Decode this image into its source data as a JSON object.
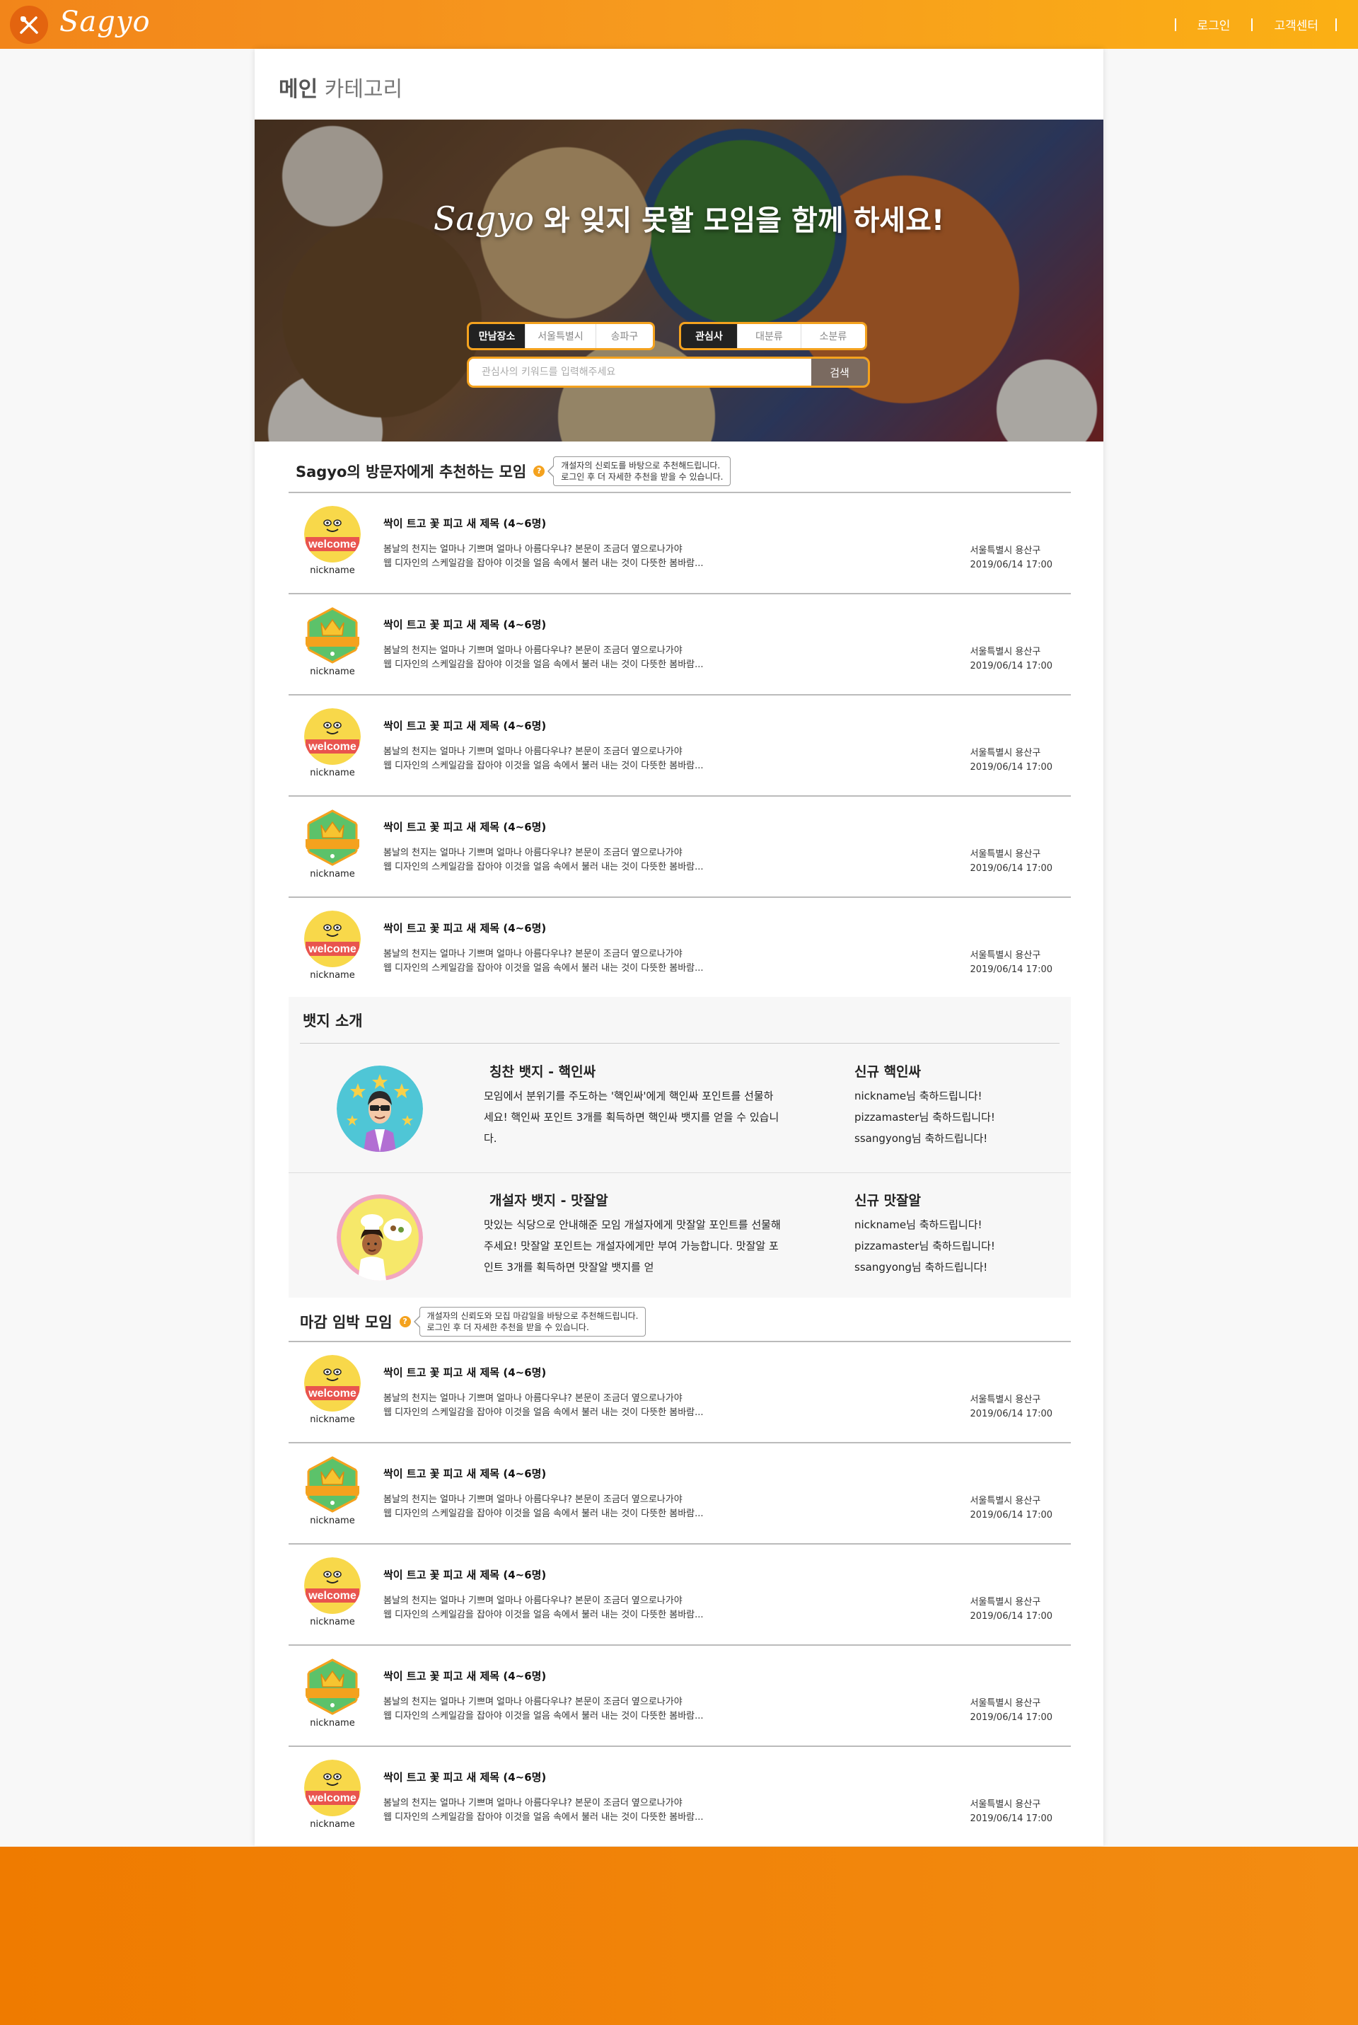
{
  "header": {
    "logo_text": "Sagyo",
    "nav": [
      "로그인",
      "고객센터"
    ],
    "accent": "#f7941d"
  },
  "page": {
    "heading_main": "메인",
    "heading_sub": "카테고리"
  },
  "hero": {
    "brand": "Sagyo",
    "title": "와 잊지 못할 모임을 함께 하세요!",
    "place_filter": [
      "만남장소",
      "서울특별시",
      "송파구"
    ],
    "interest_filter": [
      "관심사",
      "대분류",
      "소분류"
    ],
    "search_placeholder": "관심사의 키워드를 입력해주세요",
    "search_button": "검색"
  },
  "recommend": {
    "title": "Sagyo의 방문자에게 추천하는 모임",
    "help_icon": "question-icon",
    "tooltip": [
      "개설자의 신뢰도를 바탕으로 추천해드립니다.",
      "로그인 후 더 자세한 추천을 받을 수 있습니다."
    ],
    "items": [
      {
        "avatar": "welcome",
        "nickname": "nickname",
        "title": "싹이 트고 꽃 피고 새 제목 (4~6명)",
        "desc1": "봄날의 천지는 얼마나 기쁘며 얼마나 아름다우냐? 본문이 조금더 옆으로나가야",
        "desc2": "웹 디자인의 스케일감을 잡아야 이것을 얼음 속에서 불러 내는 것이 다뜻한 봄바람...",
        "location": "서울특별시 용산구",
        "datetime": "2019/06/14  17:00"
      },
      {
        "avatar": "badge",
        "nickname": "nickname",
        "title": "싹이 트고 꽃 피고 새 제목 (4~6명)",
        "desc1": "봄날의 천지는 얼마나 기쁘며 얼마나 아름다우냐? 본문이 조금더 옆으로나가야",
        "desc2": "웹 디자인의 스케일감을 잡아야 이것을 얼음 속에서 불러 내는 것이 다뜻한 봄바람...",
        "location": "서울특별시 용산구",
        "datetime": "2019/06/14  17:00"
      },
      {
        "avatar": "welcome",
        "nickname": "nickname",
        "title": "싹이 트고 꽃 피고 새 제목 (4~6명)",
        "desc1": "봄날의 천지는 얼마나 기쁘며 얼마나 아름다우냐? 본문이 조금더 옆으로나가야",
        "desc2": "웹 디자인의 스케일감을 잡아야 이것을 얼음 속에서 불러 내는 것이 다뜻한 봄바람...",
        "location": "서울특별시 용산구",
        "datetime": "2019/06/14  17:00"
      },
      {
        "avatar": "badge",
        "nickname": "nickname",
        "title": "싹이 트고 꽃 피고 새 제목 (4~6명)",
        "desc1": "봄날의 천지는 얼마나 기쁘며 얼마나 아름다우냐? 본문이 조금더 옆으로나가야",
        "desc2": "웹 디자인의 스케일감을 잡아야 이것을 얼음 속에서 불러 내는 것이 다뜻한 봄바람...",
        "location": "서울특별시 용산구",
        "datetime": "2019/06/14  17:00"
      },
      {
        "avatar": "welcome",
        "nickname": "nickname",
        "title": "싹이 트고 꽃 피고 새 제목 (4~6명)",
        "desc1": "봄날의 천지는 얼마나 기쁘며 얼마나 아름다우냐? 본문이 조금더 옆으로나가야",
        "desc2": "웹 디자인의 스케일감을 잡아야 이것을 얼음 속에서 불러 내는 것이 다뜻한 봄바람...",
        "location": "서울특별시 용산구",
        "datetime": "2019/06/14  17:00"
      }
    ]
  },
  "badges": {
    "title": "뱃지 소개",
    "rows": [
      {
        "icon": "praise-badge-icon",
        "title": "칭찬 뱃지 - 핵인싸",
        "desc": " 모임에서 분위기를 주도하는 '핵인싸'에게 핵인싸 포인트를 선물하세요! 핵인싸 포인트 3개를 획득하면 핵인싸 뱃지를 얻을 수 있습니다.",
        "new_title": "신규 핵인싸",
        "new_list": [
          "nickname님 축하드립니다!",
          "pizzamaster님 축하드립니다!",
          "ssangyong님 축하드립니다!"
        ]
      },
      {
        "icon": "chef-badge-icon",
        "title": "개설자 뱃지 - 맛잘알",
        "desc": " 맛있는 식당으로 안내해준 모임 개설자에게 맛잘알 포인트를 선물해주세요! 맛잘알 포인트는 개설자에게만 부여 가능합니다. 맛잘알 포인트 3개를 획득하면 맛잘알 뱃지를 얻",
        "new_title": "신규 맛잘알",
        "new_list": [
          "nickname님 축하드립니다!",
          "pizzamaster님 축하드립니다!",
          "ssangyong님 축하드립니다!"
        ]
      }
    ]
  },
  "deadline": {
    "title": "마감 임박 모임",
    "help_icon": "question-icon",
    "tooltip": [
      "개설자의 신뢰도와 모집 마감일을 바탕으로 추천해드립니다.",
      "로그인 후 더 자세한 추천을 받을 수 있습니다."
    ],
    "items": [
      {
        "avatar": "welcome",
        "nickname": "nickname",
        "title": "싹이 트고 꽃 피고 새 제목 (4~6명)",
        "desc1": "봄날의 천지는 얼마나 기쁘며 얼마나 아름다우냐? 본문이 조금더 옆으로나가야",
        "desc2": "웹 디자인의 스케일감을 잡아야 이것을 얼음 속에서 불러 내는 것이 다뜻한 봄바람...",
        "location": "서울특별시 용산구",
        "datetime": "2019/06/14  17:00"
      },
      {
        "avatar": "badge",
        "nickname": "nickname",
        "title": "싹이 트고 꽃 피고 새 제목 (4~6명)",
        "desc1": "봄날의 천지는 얼마나 기쁘며 얼마나 아름다우냐? 본문이 조금더 옆으로나가야",
        "desc2": "웹 디자인의 스케일감을 잡아야 이것을 얼음 속에서 불러 내는 것이 다뜻한 봄바람...",
        "location": "서울특별시 용산구",
        "datetime": "2019/06/14  17:00"
      },
      {
        "avatar": "welcome",
        "nickname": "nickname",
        "title": "싹이 트고 꽃 피고 새 제목 (4~6명)",
        "desc1": "봄날의 천지는 얼마나 기쁘며 얼마나 아름다우냐? 본문이 조금더 옆으로나가야",
        "desc2": "웹 디자인의 스케일감을 잡아야 이것을 얼음 속에서 불러 내는 것이 다뜻한 봄바람...",
        "location": "서울특별시 용산구",
        "datetime": "2019/06/14  17:00"
      },
      {
        "avatar": "badge",
        "nickname": "nickname",
        "title": "싹이 트고 꽃 피고 새 제목 (4~6명)",
        "desc1": "봄날의 천지는 얼마나 기쁘며 얼마나 아름다우냐? 본문이 조금더 옆으로나가야",
        "desc2": "웹 디자인의 스케일감을 잡아야 이것을 얼음 속에서 불러 내는 것이 다뜻한 봄바람...",
        "location": "서울특별시 용산구",
        "datetime": "2019/06/14  17:00"
      },
      {
        "avatar": "welcome",
        "nickname": "nickname",
        "title": "싹이 트고 꽃 피고 새 제목 (4~6명)",
        "desc1": "봄날의 천지는 얼마나 기쁘며 얼마나 아름다우냐? 본문이 조금더 옆으로나가야",
        "desc2": "웹 디자인의 스케일감을 잡아야 이것을 얼음 속에서 불러 내는 것이 다뜻한 봄바람...",
        "location": "서울특별시 용산구",
        "datetime": "2019/06/14  17:00"
      }
    ]
  }
}
